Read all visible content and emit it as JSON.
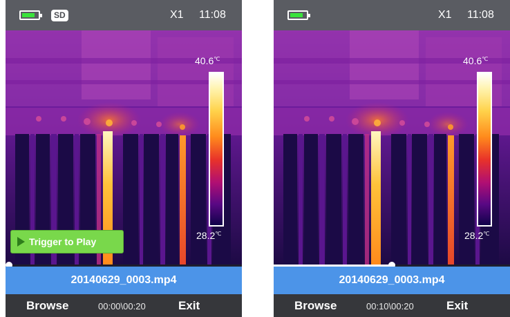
{
  "screens": [
    {
      "status": {
        "battery_icon": "battery-icon",
        "sd_label": "SD",
        "zoom": "X1",
        "time": "11:08"
      },
      "scale": {
        "max_value": "40.6",
        "min_value": "28.2",
        "unit": "℃"
      },
      "trigger_label": "Trigger to Play",
      "progress": {
        "fraction": 0.0
      },
      "filename": "20140629_0003.mp4",
      "bottom": {
        "browse_label": "Browse",
        "elapsed": "00:00\\00:20",
        "exit_label": "Exit"
      }
    },
    {
      "status": {
        "battery_icon": "battery-icon",
        "zoom": "X1",
        "time": "11:08"
      },
      "scale": {
        "max_value": "40.6",
        "min_value": "28.2",
        "unit": "℃"
      },
      "progress": {
        "fraction": 0.5
      },
      "filename": "20140629_0003.mp4",
      "bottom": {
        "browse_label": "Browse",
        "elapsed": "00:10\\00:20",
        "exit_label": "Exit"
      }
    }
  ],
  "colors": {
    "status_bar": "#5a5c62",
    "filename_bar": "#4c94e8",
    "bottom_bar": "#36373b",
    "trigger_button": "#79d84b",
    "battery_fill": "#39e33b"
  }
}
